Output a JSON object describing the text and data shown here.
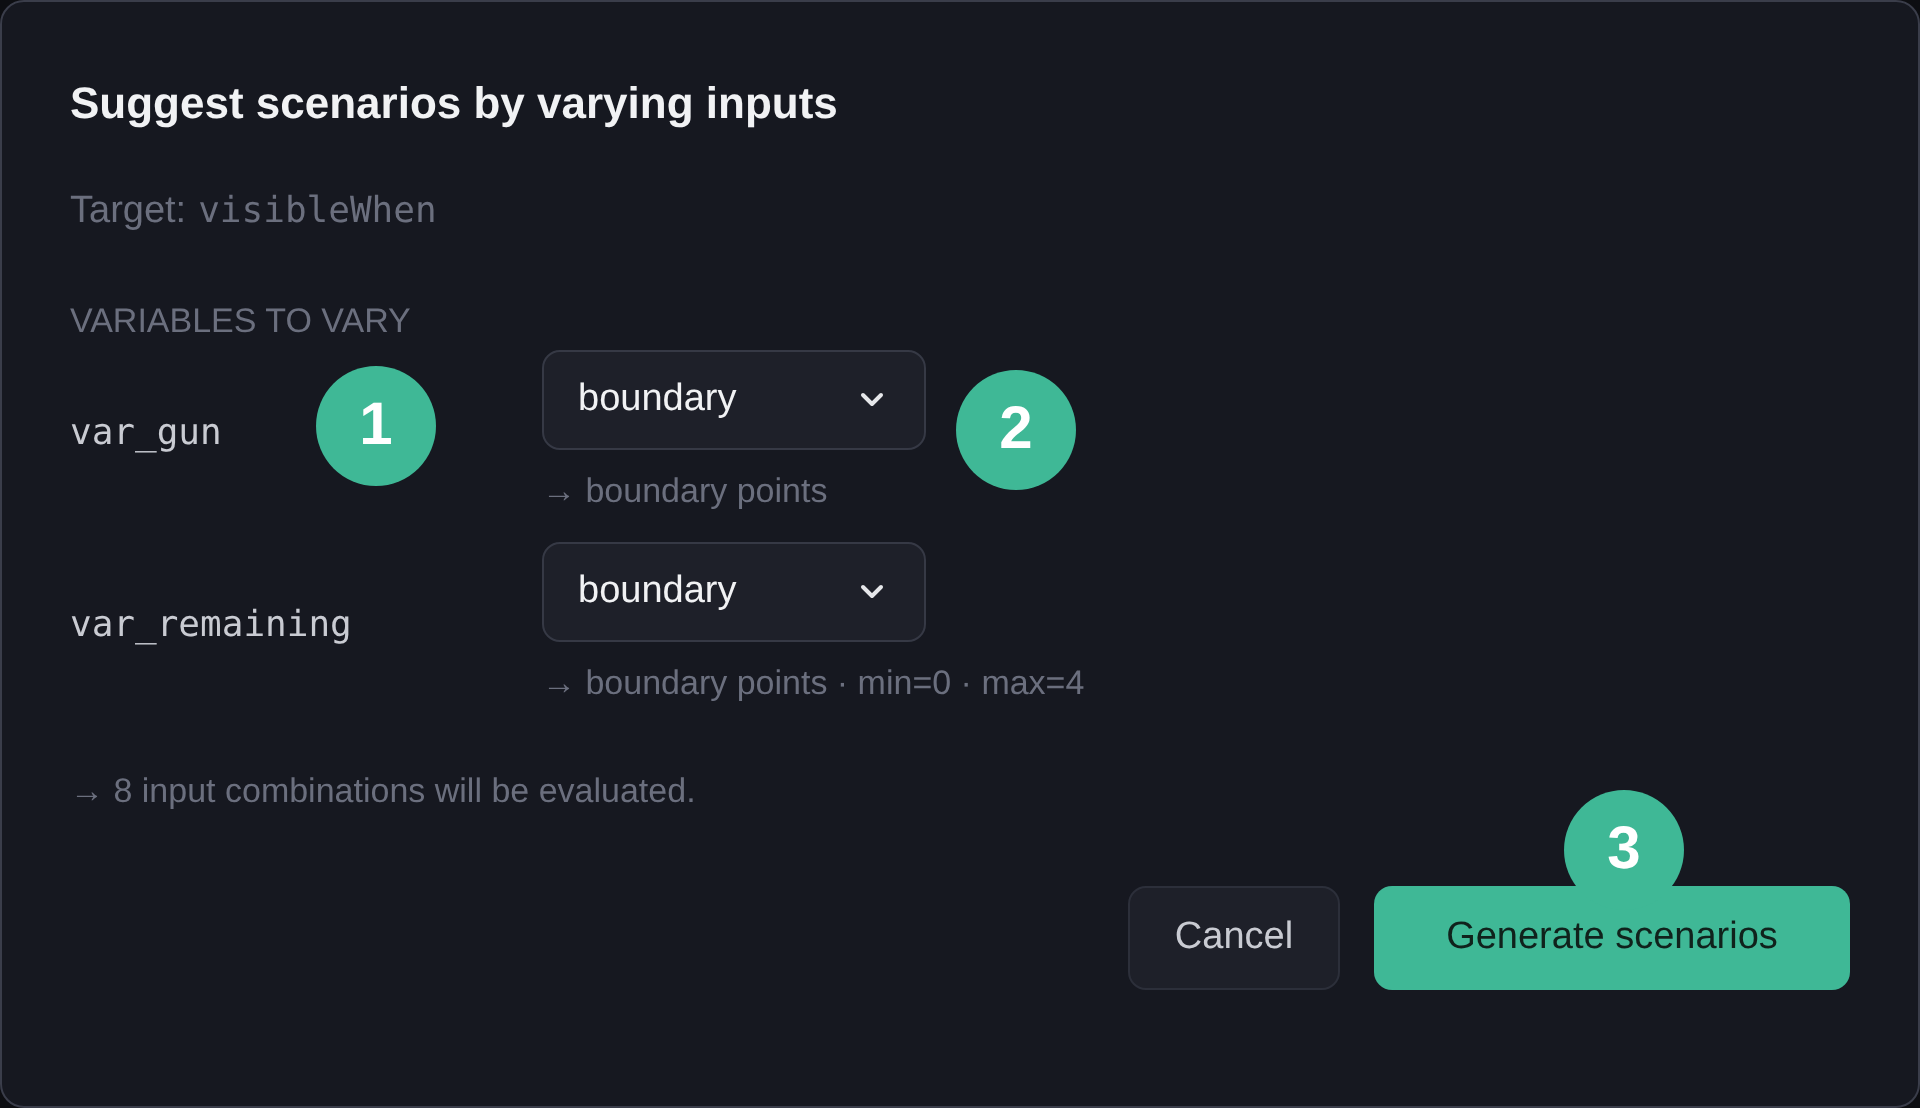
{
  "dialog": {
    "title": "Suggest scenarios by varying inputs",
    "target_label": "Target:",
    "target_value": "visibleWhen",
    "section_label": "VARIABLES TO VARY",
    "variables": [
      {
        "name": "var_gun",
        "strategy": "boundary",
        "hint": "→ boundary points"
      },
      {
        "name": "var_remaining",
        "strategy": "boundary",
        "hint": "→ boundary points · min=0 · max=4"
      }
    ],
    "summary": "→ 8 input combinations will be evaluated.",
    "buttons": [
      {
        "label": "Cancel",
        "kind": "secondary"
      },
      {
        "label": "Generate scenarios",
        "kind": "primary"
      }
    ]
  },
  "callouts": [
    "1",
    "2",
    "3"
  ]
}
